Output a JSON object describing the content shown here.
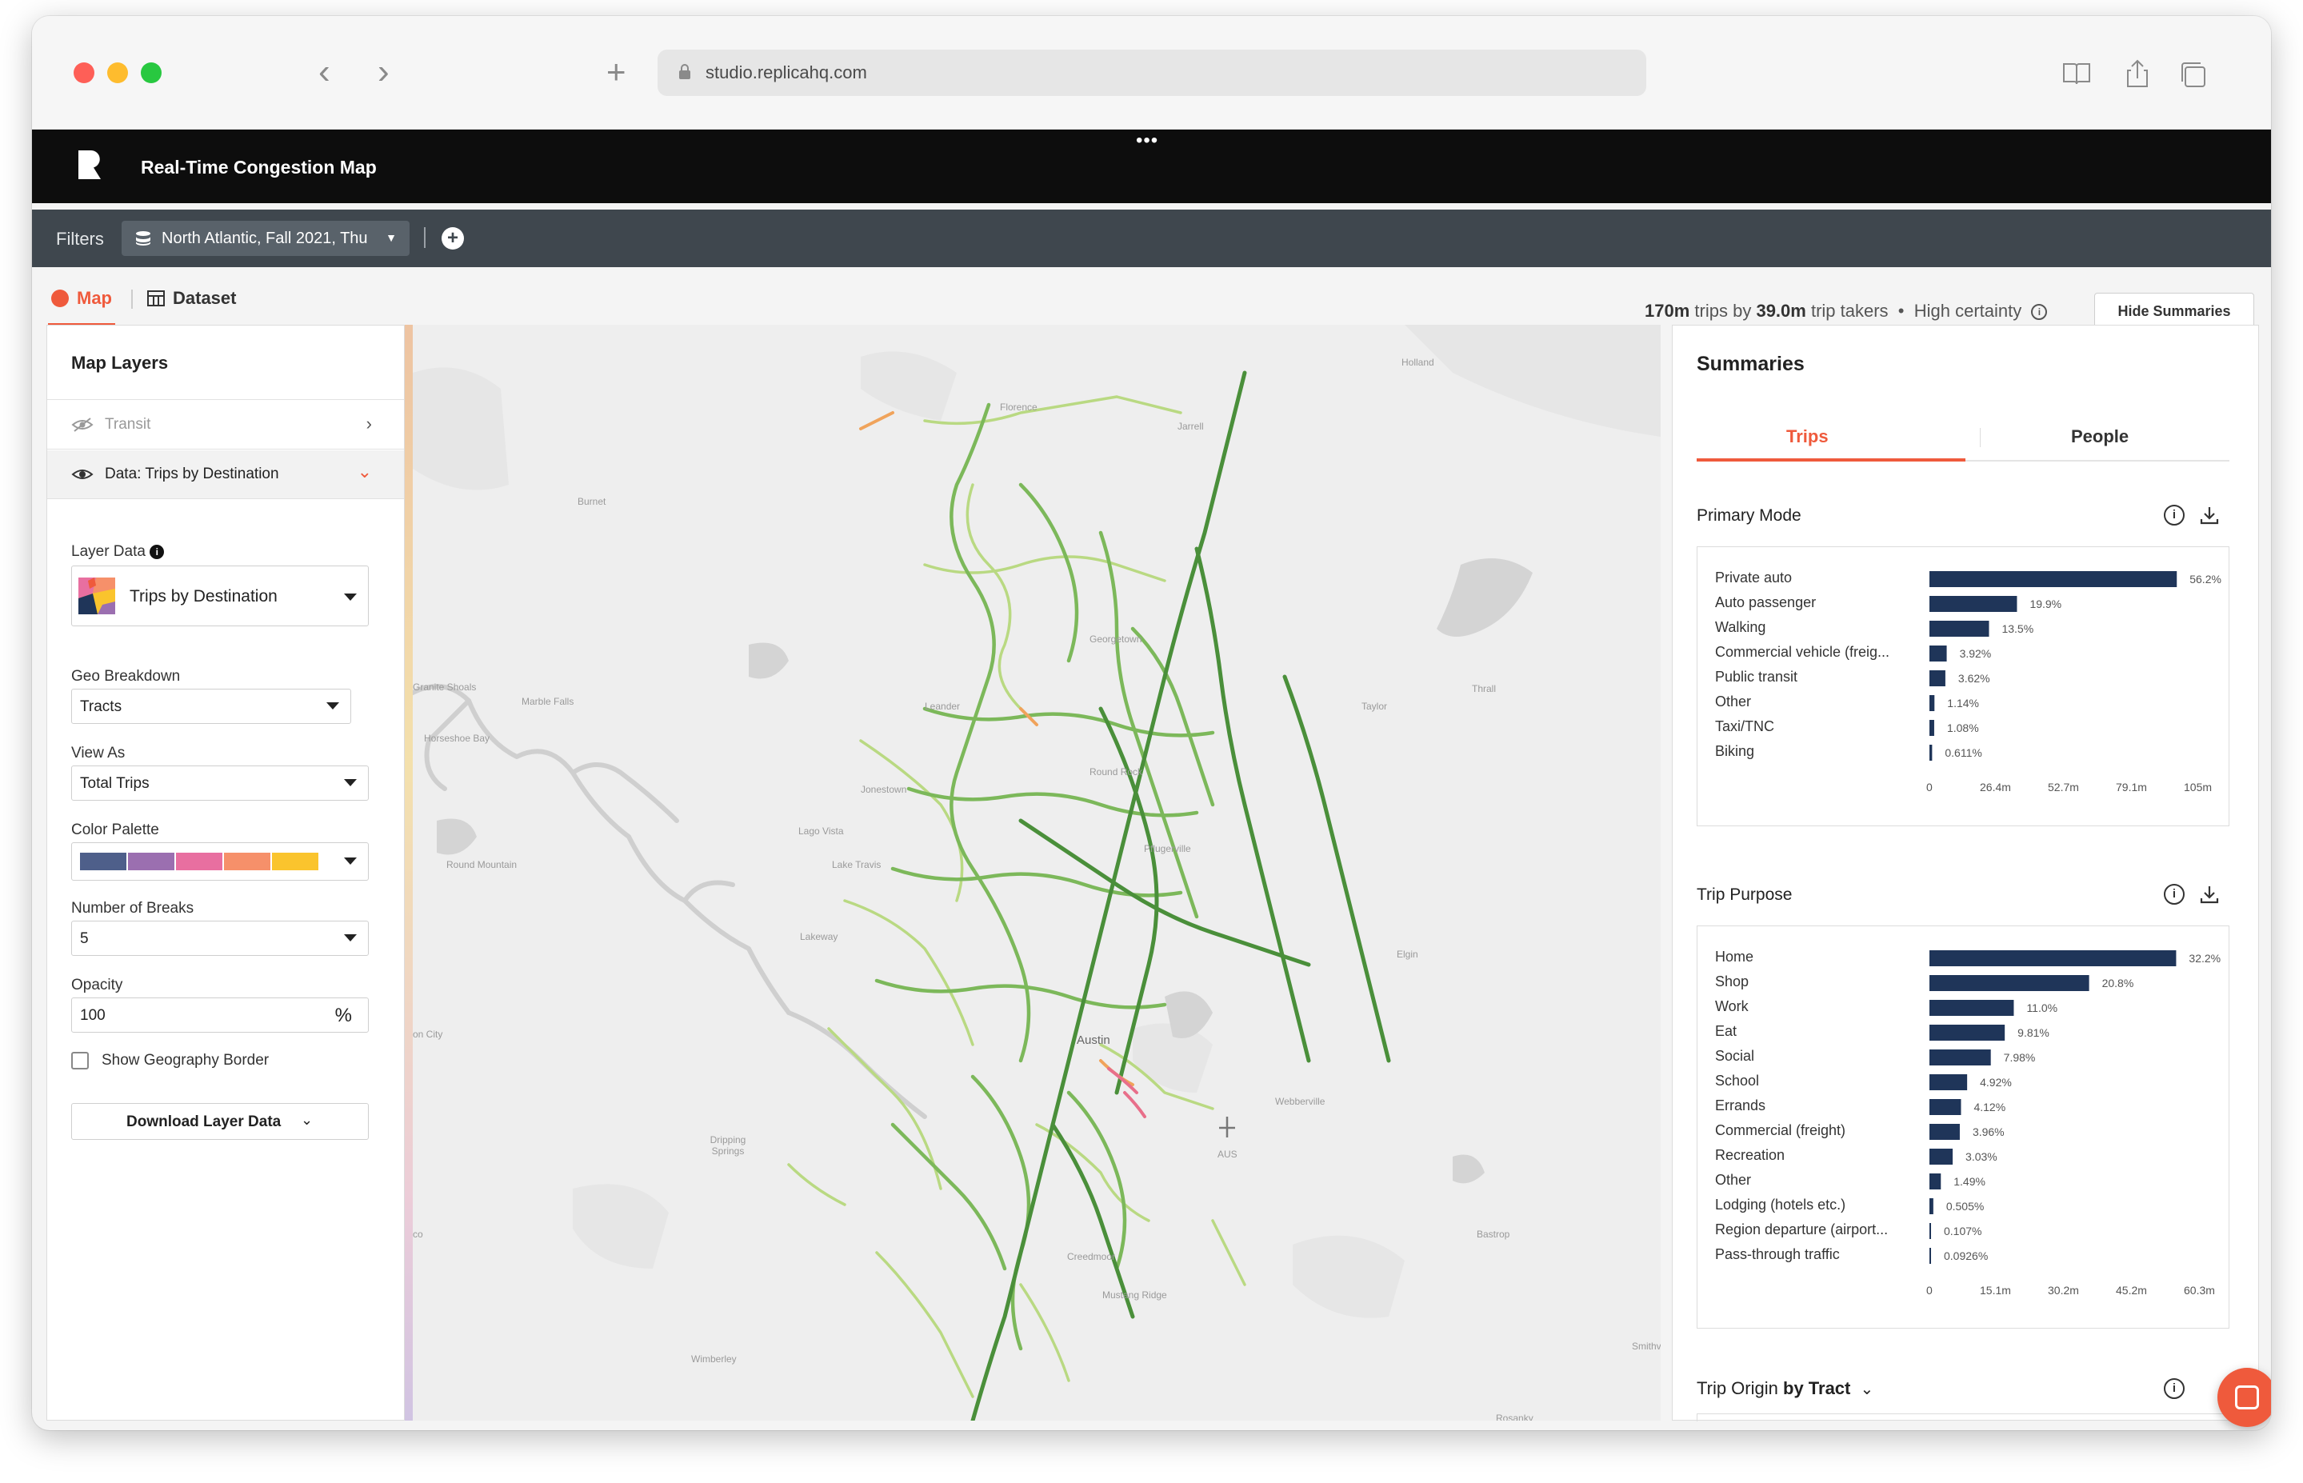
{
  "browser": {
    "url": "studio.replicahq.com"
  },
  "app": {
    "title": "Real-Time Congestion Map"
  },
  "filters": {
    "label": "Filters",
    "chip": "North Atlantic, Fall 2021, Thu"
  },
  "tabs": {
    "map": "Map",
    "dataset": "Dataset"
  },
  "stats": {
    "trips": "170m",
    "trips_label": "trips by",
    "takers": "39.0m",
    "takers_label": "trip takers",
    "certainty": "High certainty"
  },
  "hide_button": "Hide Summaries",
  "layers": {
    "title": "Map Layers",
    "transit": "Transit",
    "data_layer": "Data: Trips by Destination",
    "layer_data_label": "Layer Data",
    "layer_data_value": "Trips by Destination",
    "geo_label": "Geo Breakdown",
    "geo_value": "Tracts",
    "view_label": "View As",
    "view_value": "Total Trips",
    "palette_label": "Color Palette",
    "palette_colors": [
      "#4e5f8a",
      "#9b6fb0",
      "#e86fa0",
      "#f6906a",
      "#fac42d"
    ],
    "breaks_label": "Number of Breaks",
    "breaks_value": "5",
    "opacity_label": "Opacity",
    "opacity_value": "100",
    "opacity_unit": "%",
    "border_label": "Show Geography Border",
    "download": "Download Layer Data"
  },
  "map_labels": {
    "holland": "Holland",
    "florence": "Florence",
    "jarrell": "Jarrell",
    "burnet": "Burnet",
    "georgetown": "Georgetown",
    "granite_shoals": "Granite Shoals",
    "marble_falls": "Marble Falls",
    "horseshoe_bay": "Horseshoe Bay",
    "leander": "Leander",
    "thrall": "Thrall",
    "taylor": "Taylor",
    "jonestown": "Jonestown",
    "round_rock": "Round Rock",
    "lago_vista": "Lago Vista",
    "lake_travis": "Lake Travis",
    "pflugerville": "Pflugerville",
    "round_mountain": "Round Mountain",
    "lakeway": "Lakeway",
    "elgin": "Elgin",
    "austin": "Austin",
    "webberville": "Webberville",
    "dripping_springs": "Dripping Springs",
    "aus": "AUS",
    "bastrop": "Bastrop",
    "creedmoor": "Creedmoor",
    "mustang_ridge": "Mustang Ridge",
    "wimberley": "Wimberley",
    "smithville": "Smithville",
    "rosanky": "Rosanky",
    "johnson_city": "on City",
    "blanco": "co"
  },
  "summaries": {
    "title": "Summaries",
    "tab_trips": "Trips",
    "tab_people": "People",
    "origin_label": "Trip Origin",
    "origin_by": "by Tract"
  },
  "chart_data": [
    {
      "type": "bar",
      "title": "Primary Mode",
      "categories": [
        "Private auto",
        "Auto passenger",
        "Walking",
        "Commercial vehicle (freig...",
        "Public transit",
        "Other",
        "Taxi/TNC",
        "Biking"
      ],
      "values": [
        95.5,
        33.8,
        23.0,
        6.66,
        6.15,
        1.94,
        1.84,
        1.04
      ],
      "value_labels": [
        "56.2%",
        "19.9%",
        "13.5%",
        "3.92%",
        "3.62%",
        "1.14%",
        "1.08%",
        "0.611%"
      ],
      "xticks": [
        "0",
        "26.4m",
        "52.7m",
        "79.1m",
        "105m"
      ],
      "xlim": [
        0,
        105
      ],
      "color": "#1f3559"
    },
    {
      "type": "bar",
      "title": "Trip Purpose",
      "categories": [
        "Home",
        "Shop",
        "Work",
        "Eat",
        "Social",
        "School",
        "Errands",
        "Commercial (freight)",
        "Recreation",
        "Other",
        "Lodging (hotels etc.)",
        "Region departure (airport...",
        "Pass-through traffic"
      ],
      "values": [
        54.7,
        35.4,
        18.7,
        16.7,
        13.6,
        8.36,
        7.0,
        6.73,
        5.15,
        2.53,
        0.86,
        0.18,
        0.16
      ],
      "value_labels": [
        "32.2%",
        "20.8%",
        "11.0%",
        "9.81%",
        "7.98%",
        "4.92%",
        "4.12%",
        "3.96%",
        "3.03%",
        "1.49%",
        "0.505%",
        "0.107%",
        "0.0926%"
      ],
      "xticks": [
        "0",
        "15.1m",
        "30.2m",
        "45.2m",
        "60.3m"
      ],
      "xlim": [
        0,
        60.3
      ],
      "color": "#1f3559"
    }
  ]
}
